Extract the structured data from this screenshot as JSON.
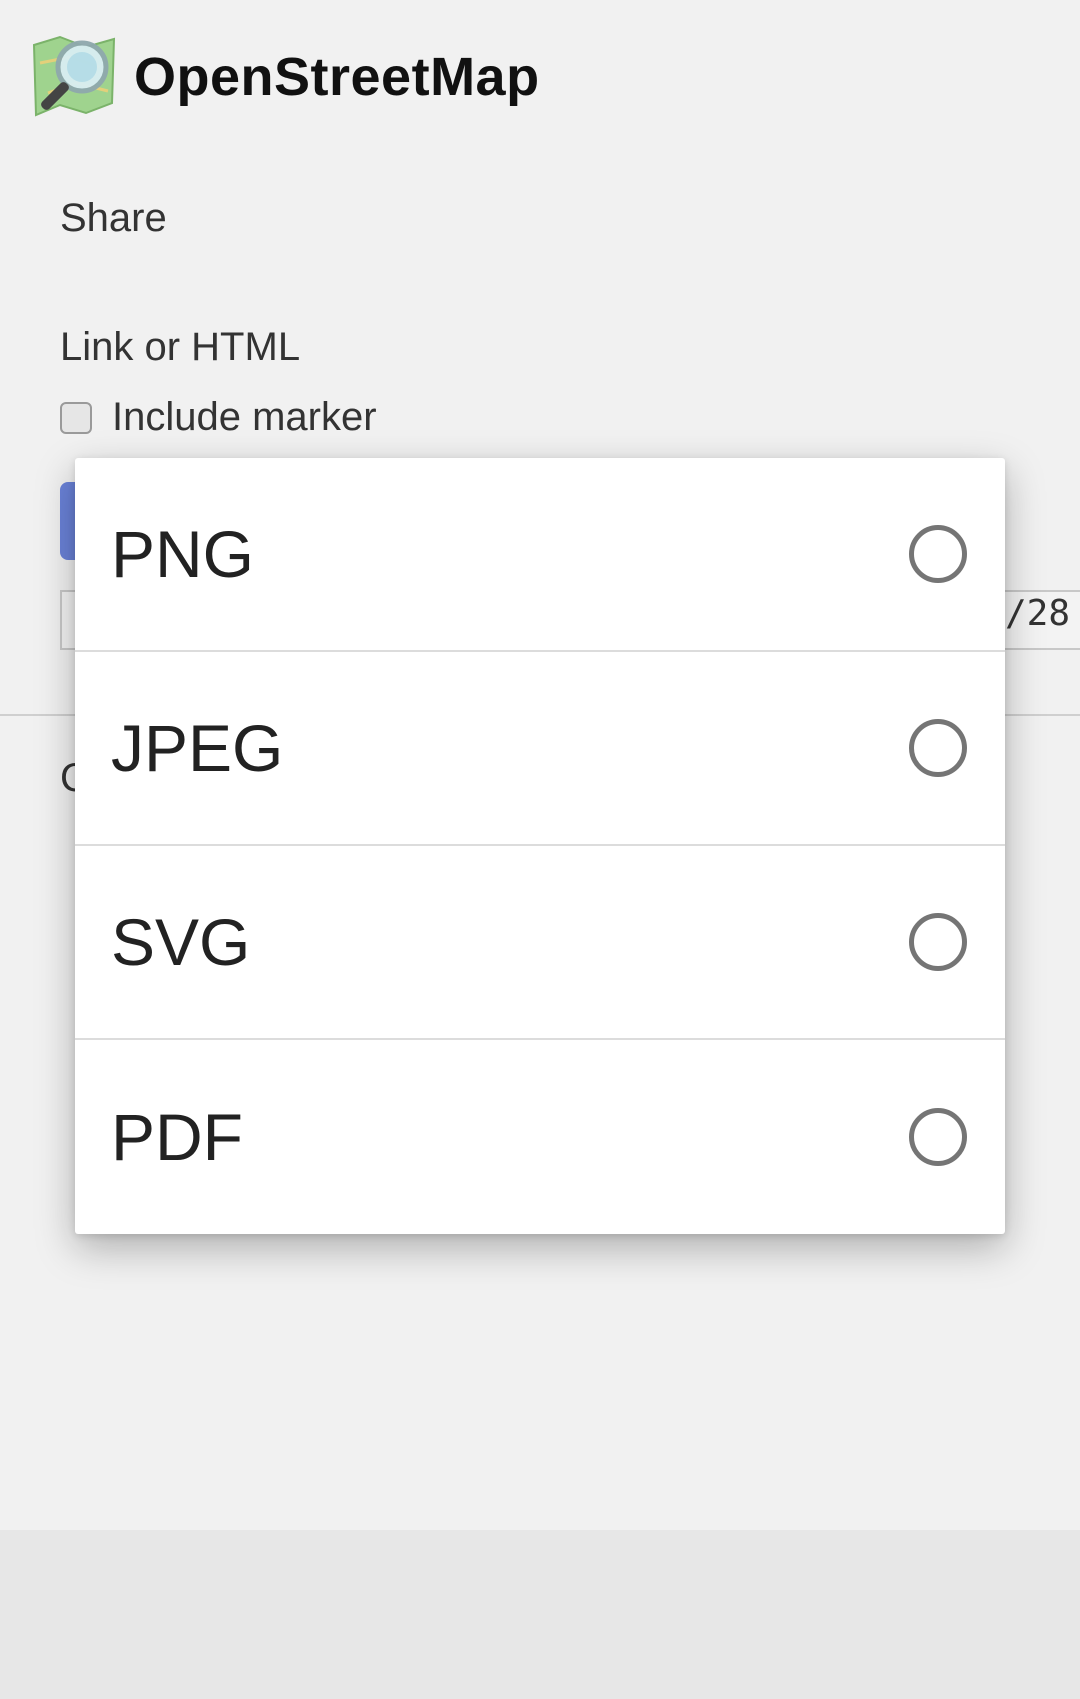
{
  "header": {
    "title": "OpenStreetMap",
    "logo_icon": "openstreetmap-logo-icon"
  },
  "share": {
    "heading": "Share",
    "link_label": "Link or HTML",
    "include_marker_label": "Include marker",
    "include_marker_checked": false,
    "input_visible_tail": "/28",
    "partial_heading_char": "C"
  },
  "format_dialog": {
    "options": [
      {
        "label": "PNG",
        "selected": false
      },
      {
        "label": "JPEG",
        "selected": false
      },
      {
        "label": "SVG",
        "selected": false
      },
      {
        "label": "PDF",
        "selected": false
      }
    ]
  },
  "colors": {
    "button_accent": "#6a82d8",
    "page_bg": "#f1f1f1",
    "dialog_bg": "#ffffff",
    "radio_ring": "#757575"
  }
}
